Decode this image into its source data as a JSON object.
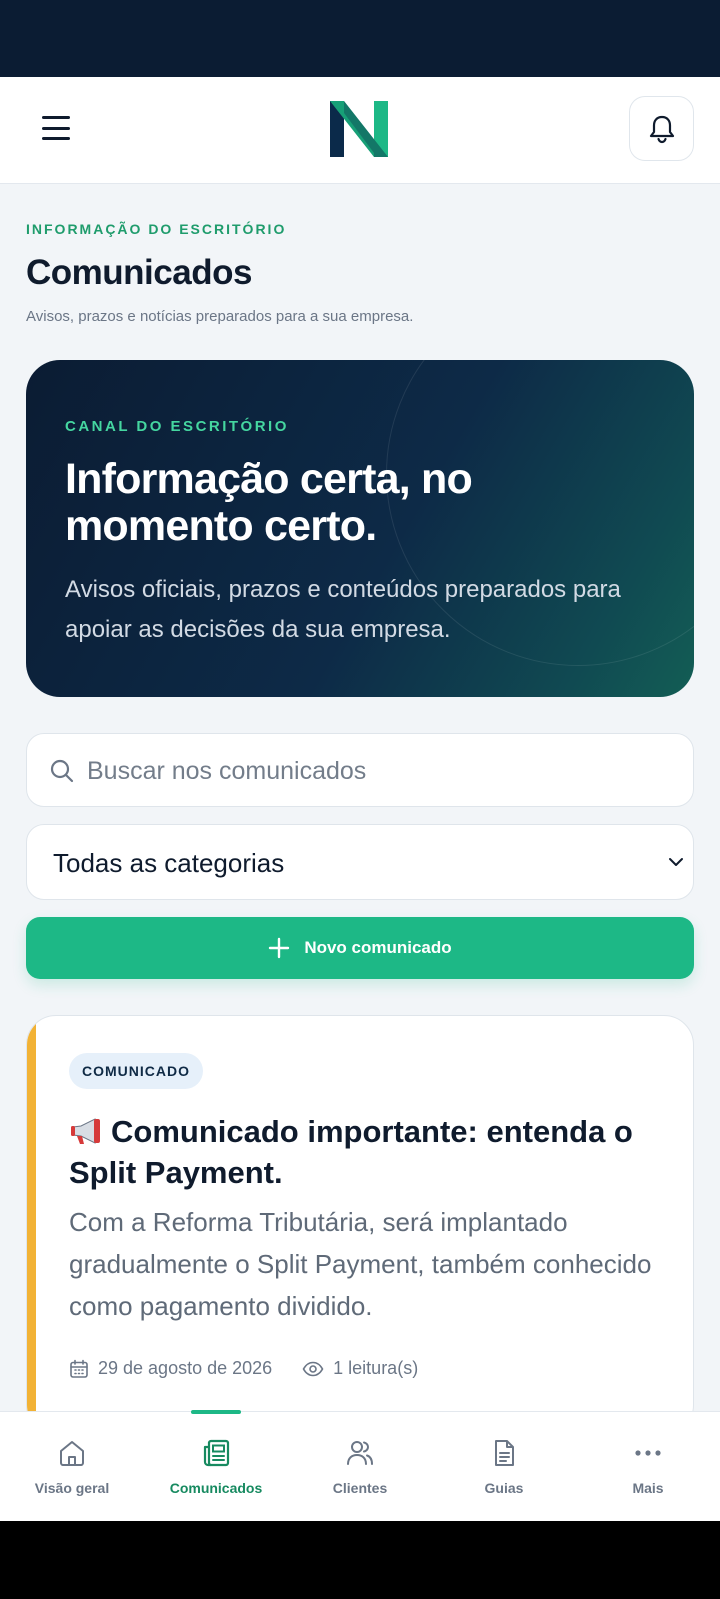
{
  "header": {
    "logo_letter": "N",
    "accent_color": "#1db886",
    "navy_color": "#0b1c33"
  },
  "page": {
    "eyebrow": "INFORMAÇÃO DO ESCRITÓRIO",
    "title": "Comunicados",
    "subtitle": "Avisos, prazos e notícias preparados para a sua empresa."
  },
  "hero": {
    "eyebrow": "CANAL DO ESCRITÓRIO",
    "title": "Informação certa, no momento certo.",
    "text": "Avisos oficiais, prazos e conteúdos preparados para apoiar as decisões da sua empresa."
  },
  "search": {
    "placeholder": "Buscar nos comunicados",
    "value": ""
  },
  "filter": {
    "selected": "Todas as categorias"
  },
  "actions": {
    "new_label": "Novo comunicado"
  },
  "posts": [
    {
      "badge": "COMUNICADO",
      "icon": "megaphone-emoji",
      "title": "Comunicado importante: entenda o Split Payment.",
      "excerpt": "Com a Reforma Tributária, será implantado gradualmente o Split Payment, também conhecido como pagamento dividido.",
      "date": "29 de agosto de 2026",
      "reads": "1 leitura(s)",
      "accent_color": "#f2b235"
    }
  ],
  "nav": {
    "items": [
      {
        "label": "Visão geral",
        "icon": "home-icon"
      },
      {
        "label": "Comunicados",
        "icon": "newspaper-icon",
        "active": true
      },
      {
        "label": "Clientes",
        "icon": "users-icon"
      },
      {
        "label": "Guias",
        "icon": "document-icon"
      },
      {
        "label": "Mais",
        "icon": "more-icon"
      }
    ]
  }
}
